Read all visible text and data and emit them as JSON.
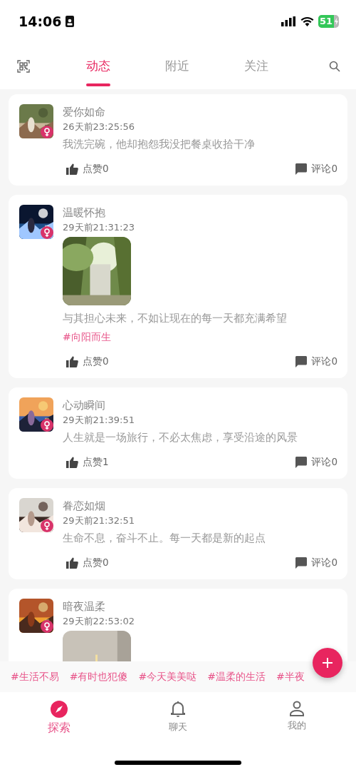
{
  "status_bar": {
    "time": "14:06",
    "battery": "51"
  },
  "tabs": [
    {
      "label": "动态",
      "selected": true
    },
    {
      "label": "附近",
      "selected": false
    },
    {
      "label": "关注",
      "selected": false
    }
  ],
  "posts": [
    {
      "author": "爱你如命",
      "time": "26天前23:25:56",
      "text": "我洗完碗，他却抱怨我没把餐桌收拾干净",
      "likes": "点赞0",
      "comments": "评论0"
    },
    {
      "author": "温暖怀抱",
      "time": "29天前21:31:23",
      "text": "与其担心未来，不如让现在的每一天都充满希望",
      "topic": "#向阳而生",
      "likes": "点赞0",
      "comments": "评论0"
    },
    {
      "author": "心动瞬间",
      "time": "29天前21:39:51",
      "text": "人生就是一场旅行，不必太焦虑，享受沿途的风景",
      "likes": "点赞1",
      "comments": "评论0"
    },
    {
      "author": "眷恋如烟",
      "time": "29天前21:32:51",
      "text": "生命不息，奋斗不止。每一天都是新的起点",
      "likes": "点赞0",
      "comments": "评论0"
    },
    {
      "author": "暗夜温柔",
      "time": "29天前22:53:02"
    }
  ],
  "topics": [
    "#生活不易",
    "#有时也犯傻",
    "#今天美美哒",
    "#温柔的生活",
    "#半夜"
  ],
  "bottom_nav": [
    {
      "label": "探索",
      "selected": true
    },
    {
      "label": "聊天",
      "selected": false
    },
    {
      "label": "我的",
      "selected": false
    }
  ]
}
